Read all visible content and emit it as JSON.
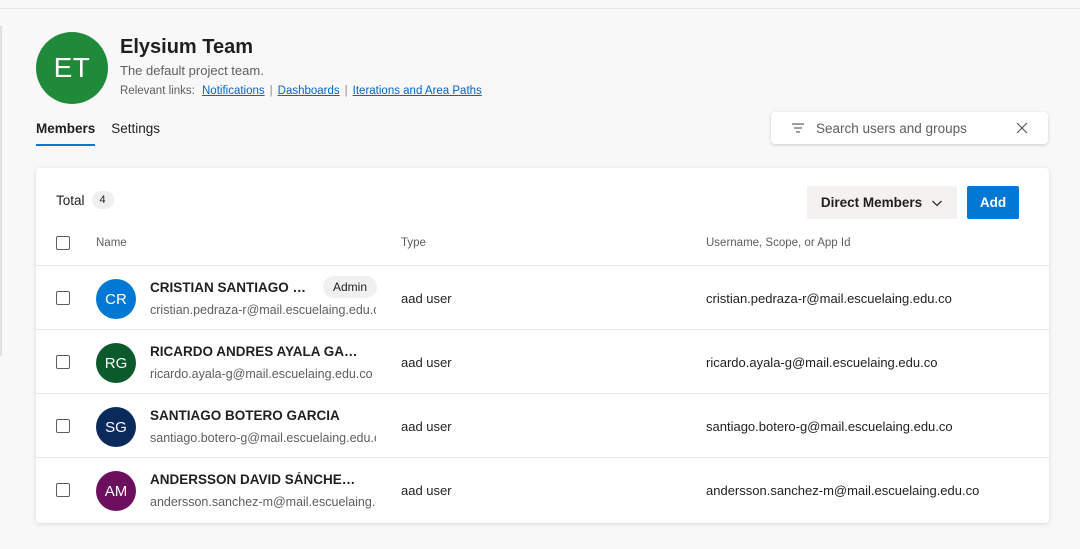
{
  "team": {
    "initials": "ET",
    "name": "Elysium Team",
    "description": "The default project team.",
    "links_label": "Relevant links:",
    "links": [
      "Notifications",
      "Dashboards",
      "Iterations and Area Paths"
    ]
  },
  "tabs": [
    "Members",
    "Settings"
  ],
  "search": {
    "placeholder": "Search users and groups",
    "value": ""
  },
  "members_panel": {
    "total_label": "Total",
    "total_count": "4",
    "filter_label": "Direct Members",
    "add_label": "Add",
    "columns": [
      "Name",
      "Type",
      "Username, Scope, or App Id"
    ],
    "rows": [
      {
        "initials": "CR",
        "avatar_color": "#0078d4",
        "name": "CRISTIAN SANTIAGO PEDRAZA RODRIGUEZ",
        "badge": "Admin",
        "email": "cristian.pedraza-r@mail.escuelaing.edu.co",
        "type": "aad user",
        "username": "cristian.pedraza-r@mail.escuelaing.edu.co"
      },
      {
        "initials": "RG",
        "avatar_color": "#0b5a2b",
        "name": "RICARDO ANDRES AYALA GARZON",
        "badge": "",
        "email": "ricardo.ayala-g@mail.escuelaing.edu.co",
        "type": "aad user",
        "username": "ricardo.ayala-g@mail.escuelaing.edu.co"
      },
      {
        "initials": "SG",
        "avatar_color": "#0b2a5c",
        "name": "SANTIAGO BOTERO GARCIA",
        "badge": "",
        "email": "santiago.botero-g@mail.escuelaing.edu.co",
        "type": "aad user",
        "username": "santiago.botero-g@mail.escuelaing.edu.co"
      },
      {
        "initials": "AM",
        "avatar_color": "#6b0f5e",
        "name": "ANDERSSON DAVID SÁNCHEZ MENDEZ",
        "badge": "",
        "email": "andersson.sanchez-m@mail.escuelaing.edu.co",
        "type": "aad user",
        "username": "andersson.sanchez-m@mail.escuelaing.edu.co"
      }
    ]
  },
  "colors": {
    "accent": "#0078d4",
    "team_avatar": "#1f8a3a",
    "link": "#0f62b8"
  }
}
